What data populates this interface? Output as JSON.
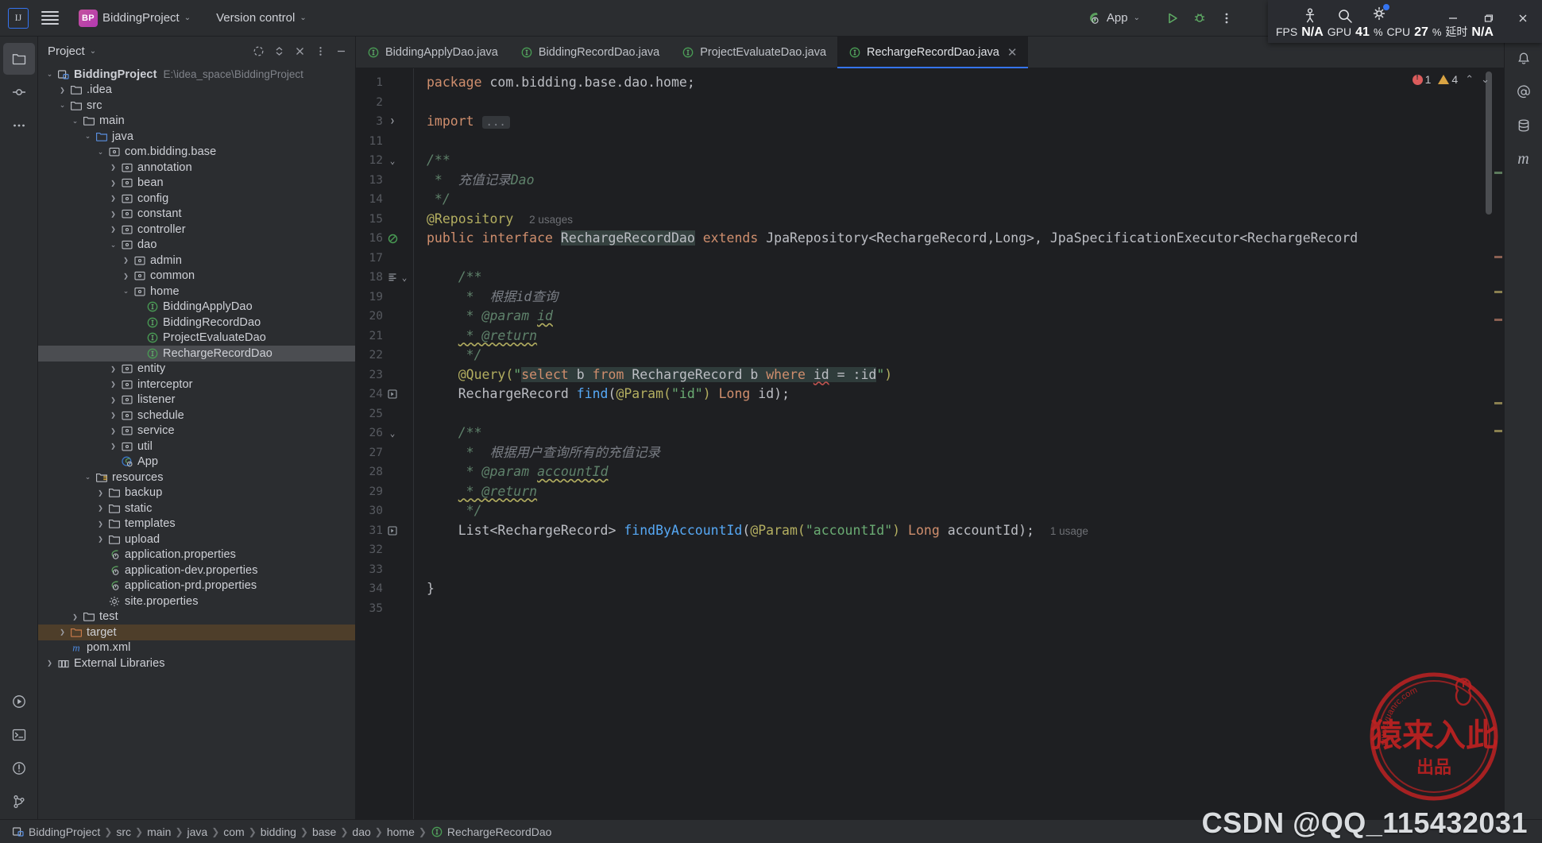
{
  "titlebar": {
    "ide_icon": "intellij-idea-icon",
    "menu_icon": "hamburger-menu-icon",
    "project_badge": "BP",
    "project_name": "BiddingProject",
    "version_control": "Version control",
    "run_config": "App",
    "run_icon": "run-icon",
    "debug_icon": "debug-icon",
    "more_icon": "more-vertical-icon"
  },
  "stats_overlay": {
    "icons": [
      "accessibility-icon",
      "search-icon",
      "settings-gear-icon"
    ],
    "fps_label": "FPS",
    "fps_value": "N/A",
    "gpu_label": "GPU",
    "gpu_value": "41",
    "gpu_unit": "%",
    "cpu_label": "CPU",
    "cpu_value": "27",
    "cpu_unit": "%",
    "latency_label": "延时",
    "latency_value": "N/A",
    "minimize": "—",
    "maximize": "□",
    "close": "✕"
  },
  "left_rail": [
    {
      "name": "project-tool-window",
      "icon": "folder-icon",
      "active": true
    },
    {
      "name": "commit-tool-window",
      "icon": "commit-icon",
      "active": false
    },
    {
      "name": "more-tool-windows",
      "icon": "ellipsis-icon",
      "active": false
    }
  ],
  "left_rail_bottom": [
    {
      "name": "run-tool-window",
      "icon": "play-circle-icon"
    },
    {
      "name": "terminal-tool-window",
      "icon": "terminal-icon"
    },
    {
      "name": "problems-tool-window",
      "icon": "warning-circle-icon"
    },
    {
      "name": "version-control-tool-window",
      "icon": "branch-icon"
    }
  ],
  "right_rail": [
    {
      "name": "notifications",
      "icon": "bell-icon"
    },
    {
      "name": "ai-assistant",
      "icon": "at-icon"
    },
    {
      "name": "database-tool-window",
      "icon": "database-icon"
    },
    {
      "name": "maven-tool-window",
      "icon": "maven-m-icon"
    }
  ],
  "project_panel": {
    "title": "Project",
    "chevron": "chevron-down-icon",
    "tools": [
      "sync-icon",
      "expand-collapse-icon",
      "hide-icon",
      "options-icon",
      "minimize-icon"
    ],
    "tree": [
      {
        "depth": 0,
        "arrow": "down",
        "icon": "module-icon",
        "label": "BiddingProject",
        "bold": true,
        "path": "E:\\idea_space\\BiddingProject"
      },
      {
        "depth": 1,
        "arrow": "right",
        "icon": "folder-icon",
        "label": ".idea"
      },
      {
        "depth": 1,
        "arrow": "down",
        "icon": "folder-icon",
        "label": "src"
      },
      {
        "depth": 2,
        "arrow": "down",
        "icon": "folder-icon",
        "label": "main"
      },
      {
        "depth": 3,
        "arrow": "down",
        "icon": "source-root-icon",
        "label": "java"
      },
      {
        "depth": 4,
        "arrow": "down",
        "icon": "package-icon",
        "label": "com.bidding.base"
      },
      {
        "depth": 5,
        "arrow": "right",
        "icon": "package-icon",
        "label": "annotation"
      },
      {
        "depth": 5,
        "arrow": "right",
        "icon": "package-icon",
        "label": "bean"
      },
      {
        "depth": 5,
        "arrow": "right",
        "icon": "package-icon",
        "label": "config"
      },
      {
        "depth": 5,
        "arrow": "right",
        "icon": "package-icon",
        "label": "constant"
      },
      {
        "depth": 5,
        "arrow": "right",
        "icon": "package-icon",
        "label": "controller"
      },
      {
        "depth": 5,
        "arrow": "down",
        "icon": "package-icon",
        "label": "dao"
      },
      {
        "depth": 6,
        "arrow": "right",
        "icon": "package-icon",
        "label": "admin"
      },
      {
        "depth": 6,
        "arrow": "right",
        "icon": "package-icon",
        "label": "common"
      },
      {
        "depth": 6,
        "arrow": "down",
        "icon": "package-icon",
        "label": "home"
      },
      {
        "depth": 7,
        "arrow": "none",
        "icon": "interface-icon",
        "label": "BiddingApplyDao"
      },
      {
        "depth": 7,
        "arrow": "none",
        "icon": "interface-icon",
        "label": "BiddingRecordDao"
      },
      {
        "depth": 7,
        "arrow": "none",
        "icon": "interface-icon",
        "label": "ProjectEvaluateDao"
      },
      {
        "depth": 7,
        "arrow": "none",
        "icon": "interface-icon",
        "label": "RechargeRecordDao",
        "selected": true
      },
      {
        "depth": 5,
        "arrow": "right",
        "icon": "package-icon",
        "label": "entity"
      },
      {
        "depth": 5,
        "arrow": "right",
        "icon": "package-icon",
        "label": "interceptor"
      },
      {
        "depth": 5,
        "arrow": "right",
        "icon": "package-icon",
        "label": "listener"
      },
      {
        "depth": 5,
        "arrow": "right",
        "icon": "package-icon",
        "label": "schedule"
      },
      {
        "depth": 5,
        "arrow": "right",
        "icon": "package-icon",
        "label": "service"
      },
      {
        "depth": 5,
        "arrow": "right",
        "icon": "package-icon",
        "label": "util"
      },
      {
        "depth": 5,
        "arrow": "none",
        "icon": "spring-boot-icon",
        "label": "App"
      },
      {
        "depth": 3,
        "arrow": "down",
        "icon": "resource-root-icon",
        "label": "resources"
      },
      {
        "depth": 4,
        "arrow": "right",
        "icon": "folder-icon",
        "label": "backup"
      },
      {
        "depth": 4,
        "arrow": "right",
        "icon": "folder-icon",
        "label": "static"
      },
      {
        "depth": 4,
        "arrow": "right",
        "icon": "folder-icon",
        "label": "templates"
      },
      {
        "depth": 4,
        "arrow": "right",
        "icon": "folder-icon",
        "label": "upload"
      },
      {
        "depth": 4,
        "arrow": "none",
        "icon": "spring-props-icon",
        "label": "application.properties"
      },
      {
        "depth": 4,
        "arrow": "none",
        "icon": "spring-props-icon",
        "label": "application-dev.properties"
      },
      {
        "depth": 4,
        "arrow": "none",
        "icon": "spring-props-icon",
        "label": "application-prd.properties"
      },
      {
        "depth": 4,
        "arrow": "none",
        "icon": "properties-icon",
        "label": "site.properties"
      },
      {
        "depth": 2,
        "arrow": "right",
        "icon": "folder-icon",
        "label": "test"
      },
      {
        "depth": 1,
        "arrow": "right",
        "icon": "excluded-folder-icon",
        "label": "target",
        "excluded": true
      },
      {
        "depth": 1,
        "arrow": "none",
        "icon": "maven-m-icon",
        "label": "pom.xml"
      },
      {
        "depth": 0,
        "arrow": "right",
        "icon": "libraries-icon",
        "label": "External Libraries"
      }
    ]
  },
  "editor": {
    "tabs": [
      {
        "label": "BiddingApplyDao.java",
        "icon": "interface-icon",
        "active": false,
        "closable": false
      },
      {
        "label": "BiddingRecordDao.java",
        "icon": "interface-icon",
        "active": false,
        "closable": false
      },
      {
        "label": "ProjectEvaluateDao.java",
        "icon": "interface-icon",
        "active": false,
        "closable": false
      },
      {
        "label": "RechargeRecordDao.java",
        "icon": "interface-icon",
        "active": true,
        "closable": true
      }
    ],
    "tab_close": "✕",
    "more_tabs_icon": "more-vertical-icon",
    "inspection": {
      "error_count": "1",
      "warning_count": "4",
      "up_icon": "chevron-up-icon",
      "down_icon": "chevron-down-icon"
    },
    "lines": [
      {
        "num": "1",
        "fold": "",
        "gutter": ""
      },
      {
        "num": "2",
        "fold": "",
        "gutter": ""
      },
      {
        "num": "3",
        "fold": "right",
        "gutter": ""
      },
      {
        "num": "11",
        "fold": "",
        "gutter": ""
      },
      {
        "num": "12",
        "fold": "down",
        "gutter": ""
      },
      {
        "num": "13",
        "fold": "",
        "gutter": ""
      },
      {
        "num": "14",
        "fold": "",
        "gutter": ""
      },
      {
        "num": "15",
        "fold": "",
        "gutter": ""
      },
      {
        "num": "16",
        "fold": "",
        "gutter": "interface-gutter-icon"
      },
      {
        "num": "17",
        "fold": "",
        "gutter": ""
      },
      {
        "num": "18",
        "fold": "down",
        "gutter": "doc-gutter-icon"
      },
      {
        "num": "19",
        "fold": "",
        "gutter": ""
      },
      {
        "num": "20",
        "fold": "",
        "gutter": ""
      },
      {
        "num": "21",
        "fold": "",
        "gutter": ""
      },
      {
        "num": "22",
        "fold": "",
        "gutter": ""
      },
      {
        "num": "23",
        "fold": "",
        "gutter": ""
      },
      {
        "num": "24",
        "fold": "",
        "gutter": "impl-gutter-icon"
      },
      {
        "num": "25",
        "fold": "",
        "gutter": ""
      },
      {
        "num": "26",
        "fold": "down",
        "gutter": ""
      },
      {
        "num": "27",
        "fold": "",
        "gutter": ""
      },
      {
        "num": "28",
        "fold": "",
        "gutter": ""
      },
      {
        "num": "29",
        "fold": "",
        "gutter": ""
      },
      {
        "num": "30",
        "fold": "",
        "gutter": ""
      },
      {
        "num": "31",
        "fold": "",
        "gutter": "impl-gutter-icon"
      },
      {
        "num": "32",
        "fold": "",
        "gutter": ""
      },
      {
        "num": "33",
        "fold": "",
        "gutter": ""
      },
      {
        "num": "34",
        "fold": "",
        "gutter": ""
      },
      {
        "num": "35",
        "fold": "",
        "gutter": ""
      }
    ],
    "code_text": [
      "package com.bidding.base.dao.home;",
      "",
      "import ...",
      "",
      "/**",
      " * 充值记录Dao",
      " */",
      "@Repository   2 usages",
      "public interface RechargeRecordDao extends JpaRepository<RechargeRecord,Long>, JpaSpecificationExecutor<RechargeRecord",
      "",
      "    /**",
      "     * 根据id查询",
      "     * @param id",
      "     * @return",
      "     */",
      "    @Query(\"select b from RechargeRecord b where id = :id\")",
      "    RechargeRecord find(@Param(\"id\") Long id);",
      "",
      "    /**",
      "     * 根据用户查询所有的充值记录",
      "     * @param accountId",
      "     * @return",
      "     */",
      "    List<RechargeRecord> findByAccountId(@Param(\"accountId\") Long accountId);   1 usage",
      "",
      "",
      "}",
      ""
    ],
    "usages": {
      "repository": "2 usages",
      "find_by_account_id": "1 usage"
    }
  },
  "status_bar": {
    "breadcrumbs": [
      {
        "label": "BiddingProject",
        "icon": "module-icon"
      },
      {
        "label": "src",
        "icon": ""
      },
      {
        "label": "main",
        "icon": ""
      },
      {
        "label": "java",
        "icon": ""
      },
      {
        "label": "com",
        "icon": ""
      },
      {
        "label": "bidding",
        "icon": ""
      },
      {
        "label": "base",
        "icon": ""
      },
      {
        "label": "dao",
        "icon": ""
      },
      {
        "label": "home",
        "icon": ""
      },
      {
        "label": "RechargeRecordDao",
        "icon": "interface-icon"
      }
    ],
    "separator": "❯"
  },
  "watermark": {
    "stamp_site": "www.yuanrc.com",
    "stamp_main": "猿来入此",
    "stamp_sub": "出品",
    "csdn_text": "CSDN @QQ_115432031"
  },
  "colors": {
    "accent": "#3574f0",
    "keyword": "#cf8e6d",
    "string": "#6aab73",
    "annotation": "#b3ae60",
    "comment": "#5f826b",
    "method": "#56a8f5",
    "bg_editor": "#1e1f22",
    "bg_panel": "#2b2d30",
    "selection": "#4b4d51",
    "excluded": "#4e3e2a"
  }
}
